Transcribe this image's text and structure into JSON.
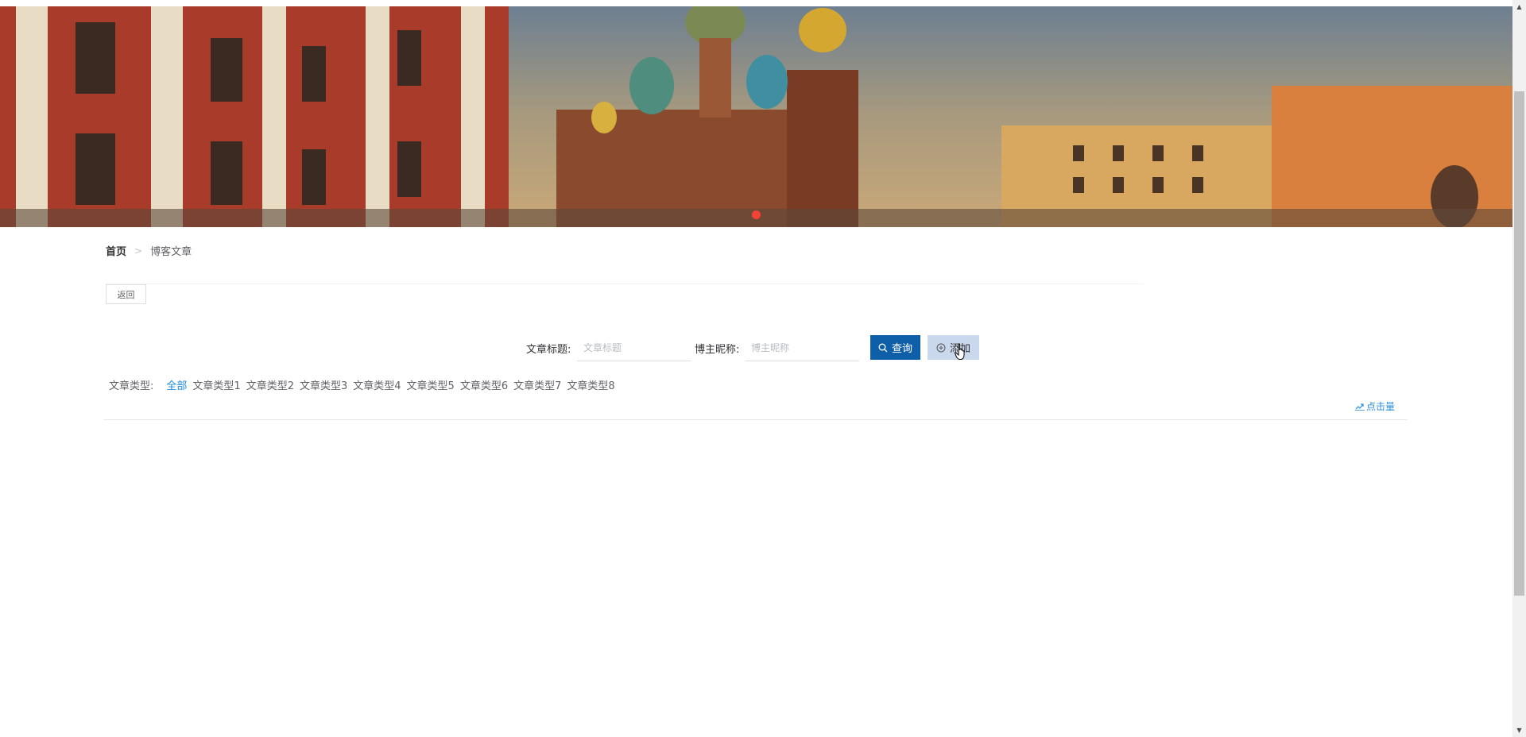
{
  "breadcrumb": {
    "home": "首页",
    "separator": ">",
    "current": "博客文章"
  },
  "back_button": {
    "label": "返回"
  },
  "search": {
    "title_label": "文章标题:",
    "title_placeholder": "文章标题",
    "nickname_label": "博主昵称:",
    "nickname_placeholder": "博主昵称",
    "query_label": "查询",
    "add_label": "添加"
  },
  "filter": {
    "label": "文章类型:",
    "items": [
      "全部",
      "文章类型1",
      "文章类型2",
      "文章类型3",
      "文章类型4",
      "文章类型5",
      "文章类型6",
      "文章类型7",
      "文章类型8"
    ],
    "active": "全部"
  },
  "sort": {
    "label": "点击量"
  },
  "colors": {
    "primary": "#0f5fa8",
    "active_link": "#1b8ad6",
    "carousel_dot": "#f44336"
  },
  "icons": {
    "search": "search-icon",
    "add": "plus-circle-icon",
    "sort": "trend-icon"
  }
}
